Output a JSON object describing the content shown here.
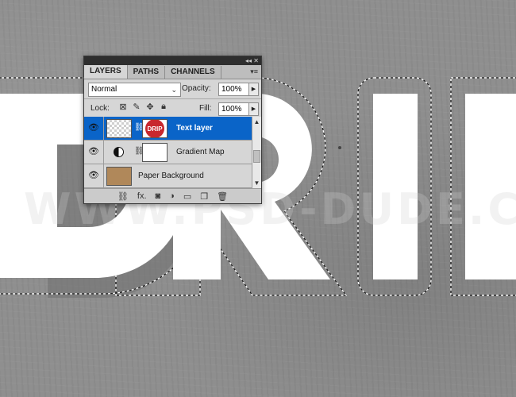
{
  "canvas": {
    "artwork_text": "DRIP",
    "watermark": "WWW.PSD-DUDE.COM"
  },
  "panel": {
    "tabs": [
      "LAYERS",
      "PATHS",
      "CHANNELS"
    ],
    "collapse_icon": "double-chevron-left",
    "close_icon": "close-x",
    "menu_icon": "panel-menu",
    "blend_mode": "Normal",
    "opacity_label": "Opacity:",
    "opacity_value": "100%",
    "lock_label": "Lock:",
    "fill_label": "Fill:",
    "fill_value": "100%",
    "layers": [
      {
        "name": "Text layer",
        "selected": true,
        "mask_text": "DRIP"
      },
      {
        "name": "Gradient Map",
        "selected": false
      },
      {
        "name": "Paper Background",
        "selected": false
      }
    ],
    "bottom_icons": [
      "link-icon",
      "fx-icon",
      "mask-icon",
      "adjustment-icon",
      "group-folder-icon",
      "new-layer-icon",
      "trash-icon"
    ],
    "fx_label": "fx.",
    "colors": {
      "selection": "#0a64c8",
      "mask_badge": "#c8282e",
      "paper_thumb": "#b0885a"
    }
  }
}
